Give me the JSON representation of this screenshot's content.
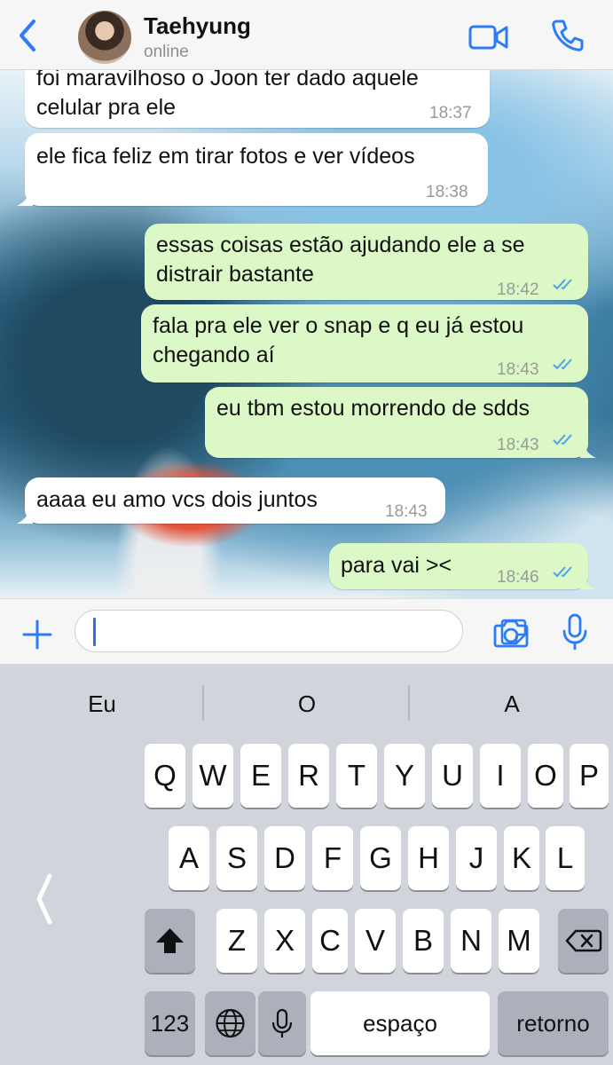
{
  "header": {
    "contact_name": "Taehyung",
    "status": "online",
    "icons": [
      "chevron-left-icon",
      "video-call-icon",
      "phone-icon"
    ],
    "accent_color": "#2b7cf6"
  },
  "messages": [
    {
      "direction": "in",
      "text_lines": [
        "foi maravilhoso o Joon ter dado aquele",
        "celular pra ele"
      ],
      "time": "18:37"
    },
    {
      "direction": "in",
      "text_lines": [
        "ele fica feliz em tirar fotos e ver vídeos"
      ],
      "time": "18:38"
    },
    {
      "direction": "out",
      "text_lines": [
        "essas coisas estão ajudando ele a se",
        "distrair bastante"
      ],
      "time": "18:42",
      "read": true
    },
    {
      "direction": "out",
      "text_lines": [
        "fala pra ele ver o snap e q eu já estou",
        "chegando aí"
      ],
      "time": "18:43",
      "read": true
    },
    {
      "direction": "out",
      "text_lines": [
        "eu tbm estou morrendo de sdds"
      ],
      "time": "18:43",
      "read": true
    },
    {
      "direction": "in",
      "text_lines": [
        "aaaa eu amo vcs dois juntos"
      ],
      "time": "18:43"
    },
    {
      "direction": "out",
      "text_lines": [
        "para vai ><"
      ],
      "time": "18:46",
      "read": true
    }
  ],
  "colors": {
    "incoming_bubble": "#ffffff",
    "outgoing_bubble": "#dcf8c6",
    "read_ticks": "#4fa3e8"
  },
  "input": {
    "value": "",
    "icons": [
      "plus-icon",
      "sticker-icon",
      "camera-icon",
      "microphone-icon"
    ]
  },
  "keyboard": {
    "suggestions": [
      "Eu",
      "O",
      "A"
    ],
    "row1": [
      "Q",
      "W",
      "E",
      "R",
      "T",
      "Y",
      "U",
      "I",
      "O",
      "P"
    ],
    "row2": [
      "A",
      "S",
      "D",
      "F",
      "G",
      "H",
      "J",
      "K",
      "L"
    ],
    "row3": [
      "Z",
      "X",
      "C",
      "V",
      "B",
      "N",
      "M"
    ],
    "numbers_key": "123",
    "space_key": "espaço",
    "return_key": "retorno",
    "icons": [
      "shift-icon",
      "backspace-icon",
      "globe-icon",
      "dictation-mic-icon",
      "chevron-left-icon"
    ]
  }
}
